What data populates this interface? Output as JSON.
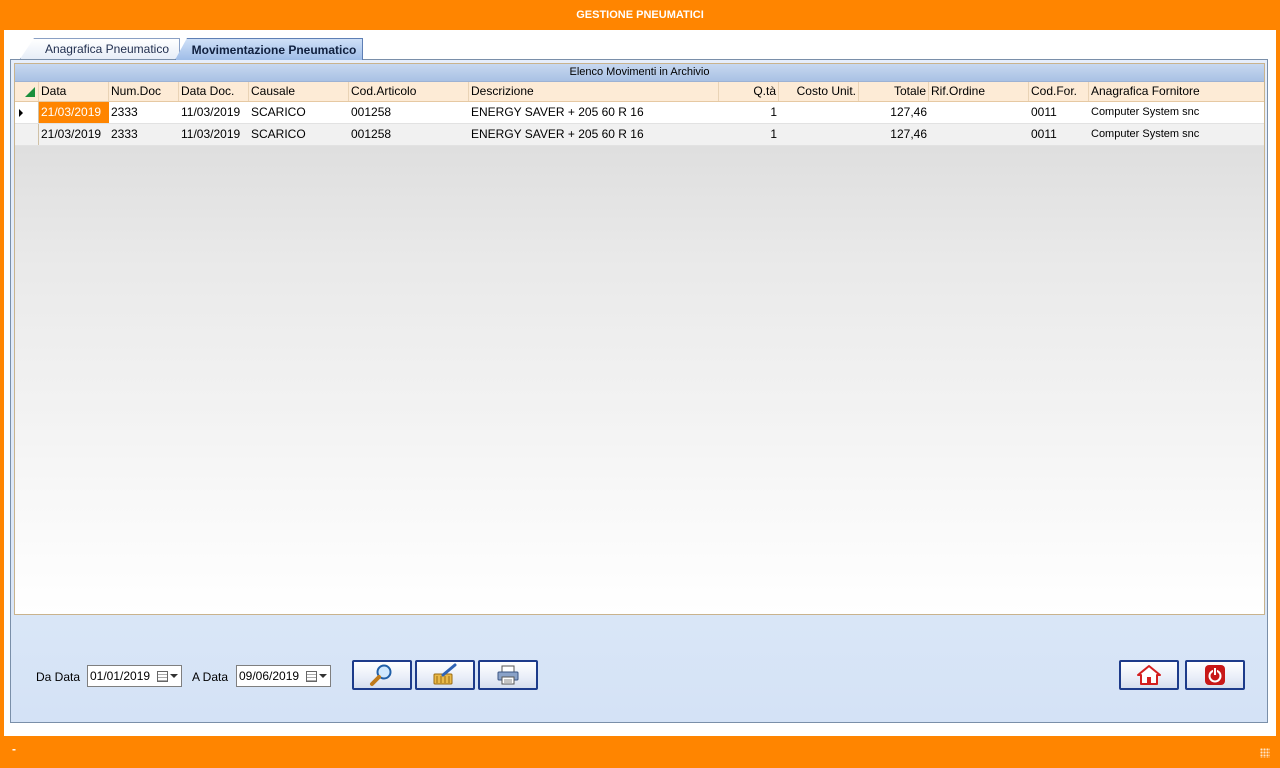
{
  "window": {
    "title": "GESTIONE PNEUMATICI"
  },
  "tabs": [
    {
      "label": "Anagrafica Pneumatico",
      "active": false
    },
    {
      "label": "Movimentazione Pneumatico",
      "active": true
    }
  ],
  "grid": {
    "caption": "Elenco Movimenti in Archivio",
    "columns": [
      "Data",
      "Num.Doc",
      "Data Doc.",
      "Causale",
      "Cod.Articolo",
      "Descrizione",
      "Q.tà",
      "Costo Unit.",
      "Totale",
      "Rif.Ordine",
      "Cod.For.",
      "Anagrafica Fornitore"
    ],
    "rows": [
      {
        "data": "21/03/2019",
        "num_doc": "2333",
        "data_doc": "11/03/2019",
        "causale": "SCARICO",
        "cod_articolo": "001258",
        "descrizione": "ENERGY SAVER + 205 60 R 16",
        "qta": "1",
        "costo_unit": "",
        "totale": "127,46",
        "rif_ordine": "",
        "cod_for": "0011",
        "fornitore": "Computer System snc"
      },
      {
        "data": "21/03/2019",
        "num_doc": "2333",
        "data_doc": "11/03/2019",
        "causale": "SCARICO",
        "cod_articolo": "001258",
        "descrizione": "ENERGY SAVER + 205 60 R 16",
        "qta": "1",
        "costo_unit": "",
        "totale": "127,46",
        "rif_ordine": "",
        "cod_for": "0011",
        "fornitore": "Computer System snc"
      }
    ]
  },
  "filters": {
    "da_data_label": "Da Data",
    "da_data_value": "01/01/2019",
    "a_data_label": "A Data",
    "a_data_value": "09/06/2019"
  },
  "buttons": {
    "search": "search-icon",
    "clear": "broom-icon",
    "print": "printer-icon",
    "home": "home-icon",
    "exit": "power-icon"
  },
  "status": {
    "text": "-"
  },
  "colors": {
    "accent": "#ff8500",
    "selection": "#ff8500",
    "button_border": "#1d3b8a"
  }
}
